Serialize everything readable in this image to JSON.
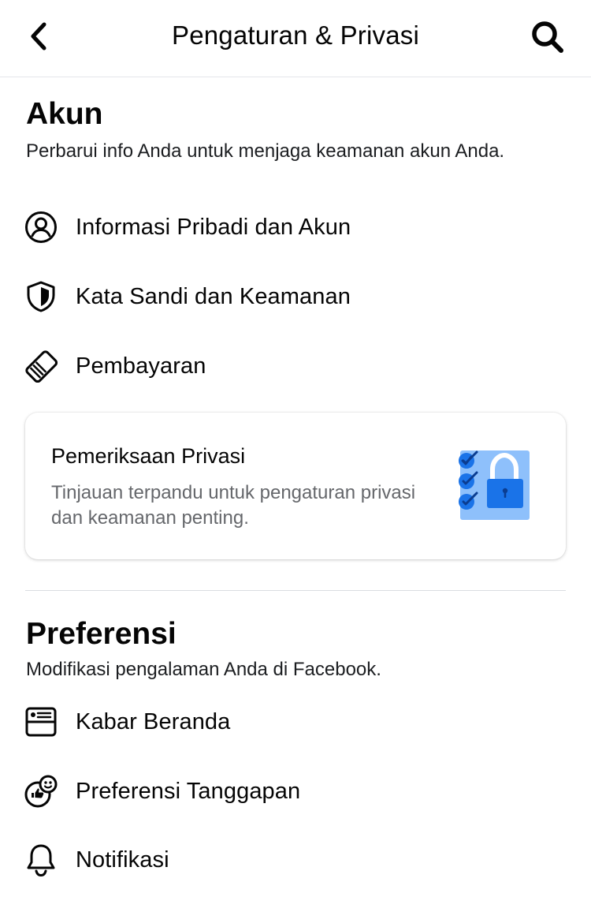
{
  "header": {
    "title": "Pengaturan & Privasi"
  },
  "account": {
    "title": "Akun",
    "description": "Perbarui info Anda untuk menjaga keamanan akun Anda.",
    "items": [
      {
        "label": "Informasi Pribadi dan Akun",
        "icon": "person-circle-icon"
      },
      {
        "label": "Kata Sandi dan Keamanan",
        "icon": "shield-icon"
      },
      {
        "label": "Pembayaran",
        "icon": "payment-card-icon"
      }
    ]
  },
  "privacy_checkup": {
    "title": "Pemeriksaan Privasi",
    "description": "Tinjauan terpandu untuk pengaturan privasi dan keamanan penting.",
    "icon": "checklist-padlock-illustration",
    "colors": {
      "light": "#8ec0fb",
      "dark": "#1a73e8",
      "accent": "#0866ff"
    }
  },
  "preferences": {
    "title": "Preferensi",
    "description": "Modifikasi pengalaman Anda di Facebook.",
    "items": [
      {
        "label": "Kabar Beranda",
        "icon": "news-feed-icon"
      },
      {
        "label": "Preferensi Tanggapan",
        "icon": "reaction-icon"
      },
      {
        "label": "Notifikasi",
        "icon": "bell-icon"
      }
    ]
  }
}
